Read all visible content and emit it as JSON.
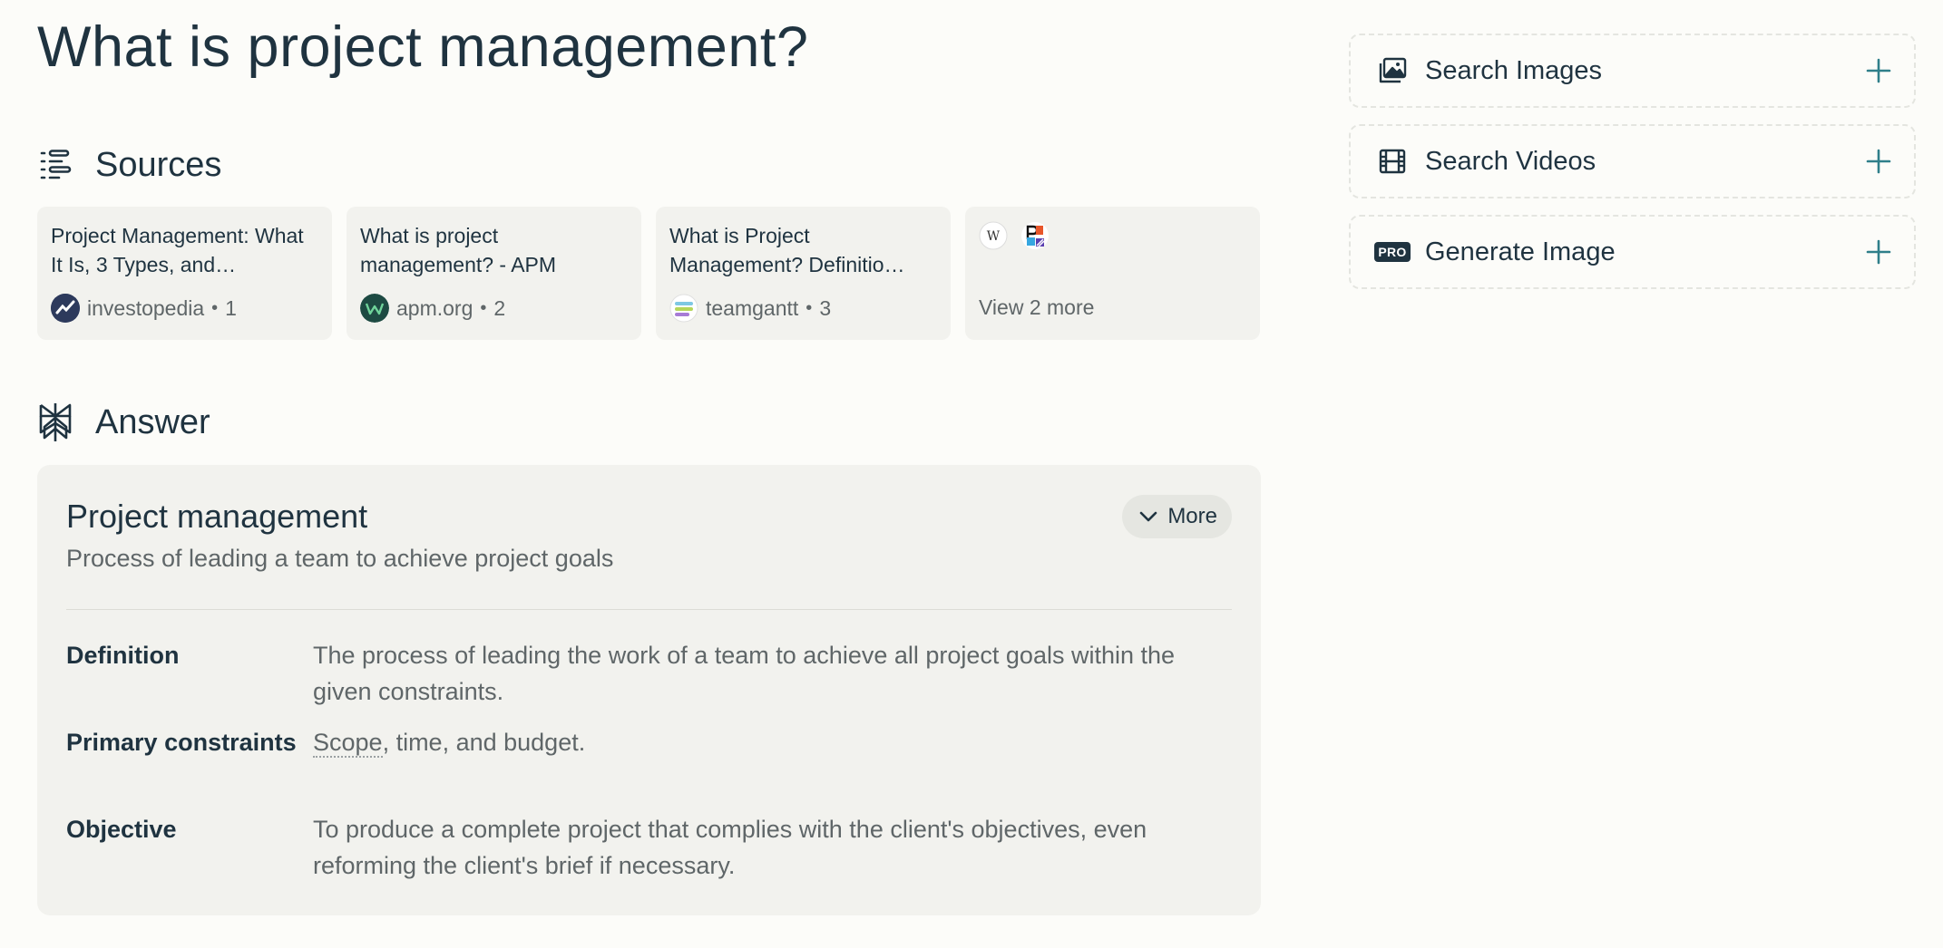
{
  "query": {
    "title": "What is project management?"
  },
  "sources": {
    "heading": "Sources",
    "icon": "sources-list-icon",
    "items": [
      {
        "title": "Project Management: What It Is, 3 Types, and…",
        "site": "investopedia",
        "index": "1",
        "favicon": "investopedia-favicon",
        "color": "#2d3a5c"
      },
      {
        "title": "What is project management? - APM",
        "site": "apm.org",
        "index": "2",
        "favicon": "apm-favicon",
        "color": "#1d4a42"
      },
      {
        "title": "What is Project Management? Definitio…",
        "site": "teamgantt",
        "index": "3",
        "favicon": "teamgantt-favicon",
        "color": "#7ec8e3"
      }
    ],
    "more": {
      "label": "View 2 more",
      "favicons": [
        "wikipedia-favicon",
        "pm-favicon"
      ]
    },
    "separator": "•"
  },
  "answer": {
    "heading": "Answer",
    "icon": "perplexity-logo-icon",
    "entity": {
      "title": "Project management",
      "subtitle": "Process of leading a team to achieve project goals",
      "more_label": "More",
      "facts": [
        {
          "label": "Definition",
          "value": "The process of leading the work of a team to achieve all project goals within the given constraints."
        },
        {
          "label": "Primary constraints",
          "value_link": "Scope",
          "value_rest": ", time, and budget."
        },
        {
          "label": "Objective",
          "value": "To produce a complete project that complies with the client's objectives, even reforming the client's brief if necessary."
        }
      ]
    }
  },
  "sidebar": {
    "actions": [
      {
        "label": "Search Images",
        "icon": "image-icon"
      },
      {
        "label": "Search Videos",
        "icon": "film-icon"
      },
      {
        "label": "Generate Image",
        "icon": "pro-badge-icon",
        "badge": "PRO"
      }
    ],
    "accent": "#2f7f8a"
  }
}
